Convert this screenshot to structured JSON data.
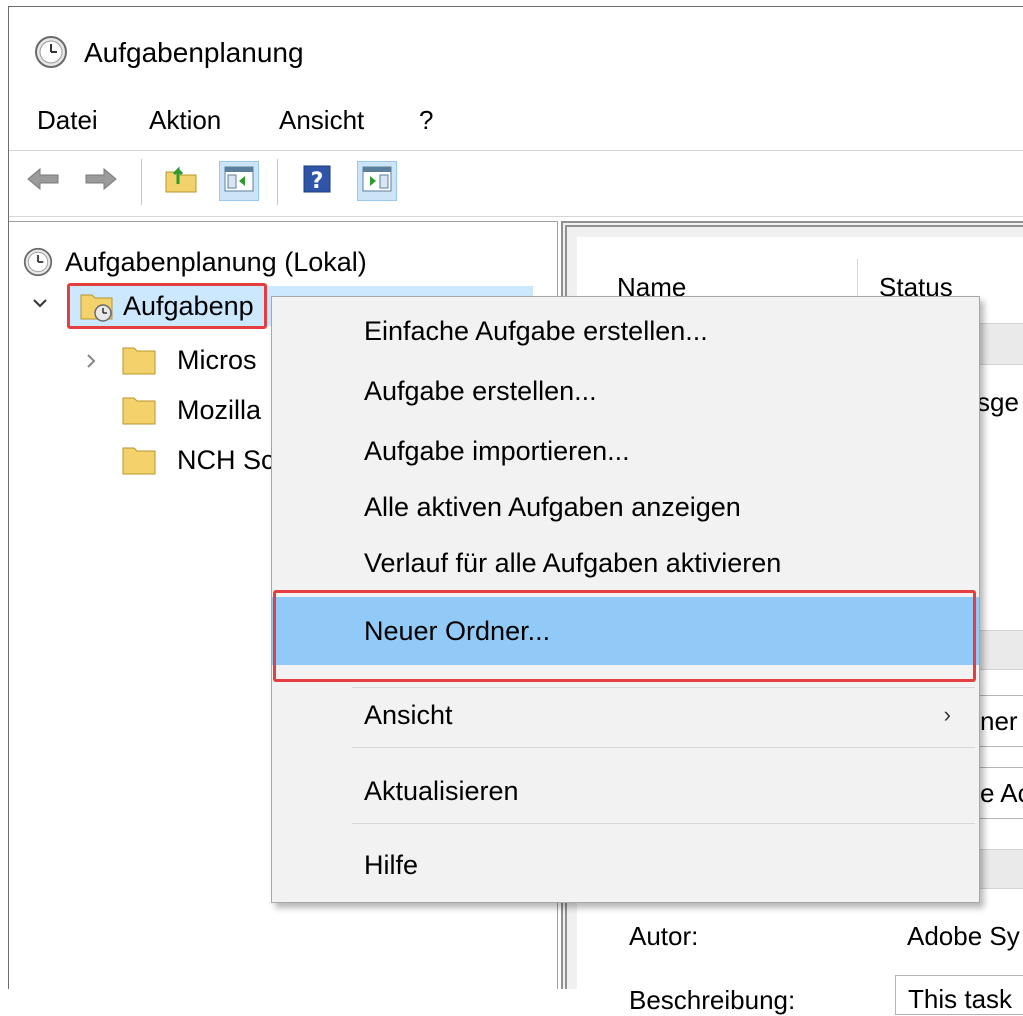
{
  "window": {
    "title": "Aufgabenplanung"
  },
  "menu": [
    "Datei",
    "Aktion",
    "Ansicht",
    "?"
  ],
  "toolbar": {
    "buttons": [
      "back-icon",
      "forward-icon",
      "folder-up-icon",
      "show-hide-console-tree-icon",
      "help-icon",
      "show-hide-action-pane-icon"
    ]
  },
  "tree": {
    "root": "Aufgabenplanung (Lokal)",
    "library": "Aufgabenplanungsbibliothek",
    "library_visible": "Aufgabenp",
    "children": [
      {
        "label": "Micros"
      },
      {
        "label": "Mozilla"
      },
      {
        "label": "NCH Sc"
      }
    ]
  },
  "right_pane": {
    "columns": [
      "Name",
      "Status"
    ],
    "status_partial": "sge",
    "partial_1": "ner",
    "partial_2": "e Ac",
    "author_label": "Autor:",
    "author_value": "Adobe Sy",
    "description_label": "Beschreibung:",
    "description_value": "This task"
  },
  "context_menu": {
    "items": [
      {
        "label": "Einfache Aufgabe erstellen..."
      },
      {
        "label": "Aufgabe erstellen..."
      },
      {
        "label": "Aufgabe importieren..."
      },
      {
        "label": "Alle aktiven Aufgaben anzeigen"
      },
      {
        "label": "Verlauf für alle Aufgaben aktivieren"
      },
      {
        "label": "Neuer Ordner..."
      },
      {
        "label": "Ansicht"
      },
      {
        "label": "Aktualisieren"
      },
      {
        "label": "Hilfe"
      }
    ],
    "submenu_arrow": "›"
  },
  "colors": {
    "highlight": "#e53e3e",
    "menu_hover": "#91c9f7",
    "selection": "#cce8ff"
  }
}
